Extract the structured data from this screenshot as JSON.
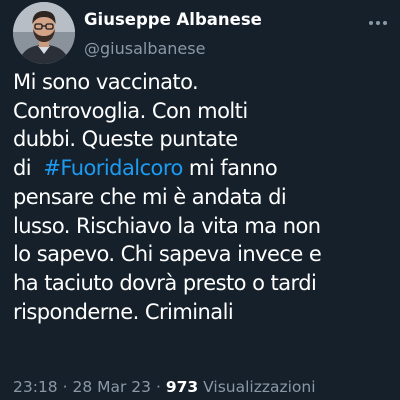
{
  "author": {
    "display_name": "Giuseppe Albanese",
    "handle": "@giusalbanese",
    "avatar_icon": "user-avatar"
  },
  "more_icon": "more-horizontal-icon",
  "tweet": {
    "lines": [
      {
        "text": "Mi sono vaccinato."
      },
      {
        "text": "Controvoglia. Con molti"
      },
      {
        "text": "dubbi. Queste puntate"
      },
      {
        "before": "di  ",
        "hashtag": "#Fuoridalcoro",
        "after": " mi fanno"
      },
      {
        "text": "pensare che mi è andata di"
      },
      {
        "text": "lusso. Rischiavo la vita ma non"
      },
      {
        "text": "lo sapevo. Chi sapeva invece e"
      },
      {
        "text": "ha taciuto dovrà presto o tardi"
      },
      {
        "text": "risponderne. Criminali"
      }
    ]
  },
  "meta": {
    "time": "23:18",
    "separator": "·",
    "date": "28 Mar 23",
    "views_count": "973",
    "views_label": "Visualizzazioni"
  },
  "colors": {
    "background": "#15202b",
    "text": "#ffffff",
    "secondary": "#8b98a5",
    "link": "#1d9bf0"
  }
}
